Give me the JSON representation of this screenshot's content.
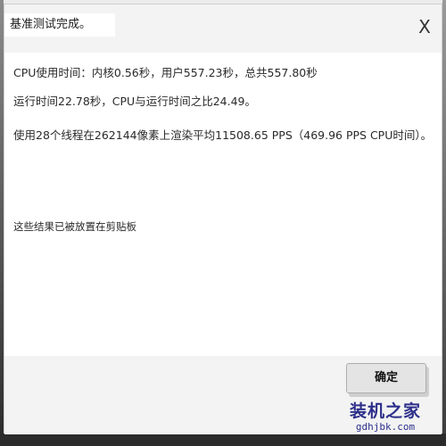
{
  "dialog": {
    "title": "基准测试完成。",
    "close_glyph": "X",
    "message": {
      "line1": "CPU使用时间：内核0.56秒，用户557.23秒，总共557.80秒",
      "line2": "运行时间22.78秒，CPU与运行时间之比24.49。",
      "line3": "使用28个线程在262144像素上渲染平均11508.65 PPS（469.96 PPS CPU时间）。"
    },
    "clipboard_note": "这些结果已被放置在剪贴板",
    "ok_button_label": "确定"
  },
  "watermark": {
    "main": "装机之家",
    "url": "gdhjbk.com"
  }
}
